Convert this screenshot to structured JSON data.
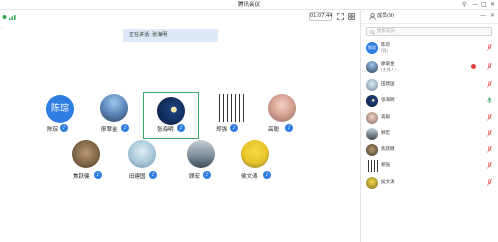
{
  "window": {
    "title": "腾讯会议"
  },
  "toolbar": {
    "timer": "01:07:44"
  },
  "banner": {
    "speaking": "正在讲话: 张海明"
  },
  "panel": {
    "title": "成员(9)",
    "search_placeholder": "搜索成员",
    "members": [
      {
        "name": "陈琮",
        "sub": "(我)",
        "avatar": "text",
        "avatar_text": "陈琮",
        "rec": false,
        "mic": "off"
      },
      {
        "name": "廖翠金",
        "sub": "(主持人)",
        "avatar": "photo",
        "rec": true,
        "mic": "off"
      },
      {
        "name": "田建国",
        "sub": "",
        "avatar": "photo",
        "rec": false,
        "mic": "off"
      },
      {
        "name": "张海明",
        "sub": "",
        "avatar": "photo",
        "rec": false,
        "mic": "on"
      },
      {
        "name": "高聪",
        "sub": "",
        "avatar": "photo",
        "rec": false,
        "mic": "off"
      },
      {
        "name": "顾宏",
        "sub": "",
        "avatar": "photo",
        "rec": false,
        "mic": "off"
      },
      {
        "name": "焦跃健",
        "sub": "",
        "avatar": "photo",
        "rec": false,
        "mic": "off"
      },
      {
        "name": "郑强",
        "sub": "",
        "avatar": "photo",
        "rec": false,
        "mic": "off"
      },
      {
        "name": "侯文涛",
        "sub": "",
        "avatar": "photo",
        "rec": false,
        "mic": "off"
      }
    ]
  },
  "grid": {
    "tiles": [
      {
        "name": "陈琮",
        "avatar_text": "陈琮"
      },
      {
        "name": "廖翠金"
      },
      {
        "name": "张海明"
      },
      {
        "name": "郑强"
      },
      {
        "name": "高聪"
      },
      {
        "name": "焦跃健"
      },
      {
        "name": "田建国"
      },
      {
        "name": "顾宏"
      },
      {
        "name": "侯文涛"
      }
    ]
  },
  "colors": {
    "accent": "#2f7de1",
    "active_border": "#3ca86a",
    "banner_bg": "#dde9f7",
    "mic_off": "#e84040",
    "mic_on": "#3ca86a"
  },
  "icons": [
    "signal-icon",
    "fullscreen-icon",
    "grid-view-icon",
    "minimize-icon",
    "maximize-icon",
    "close-icon",
    "mic-muted-icon",
    "mic-on-icon",
    "search-icon",
    "members-icon"
  ]
}
